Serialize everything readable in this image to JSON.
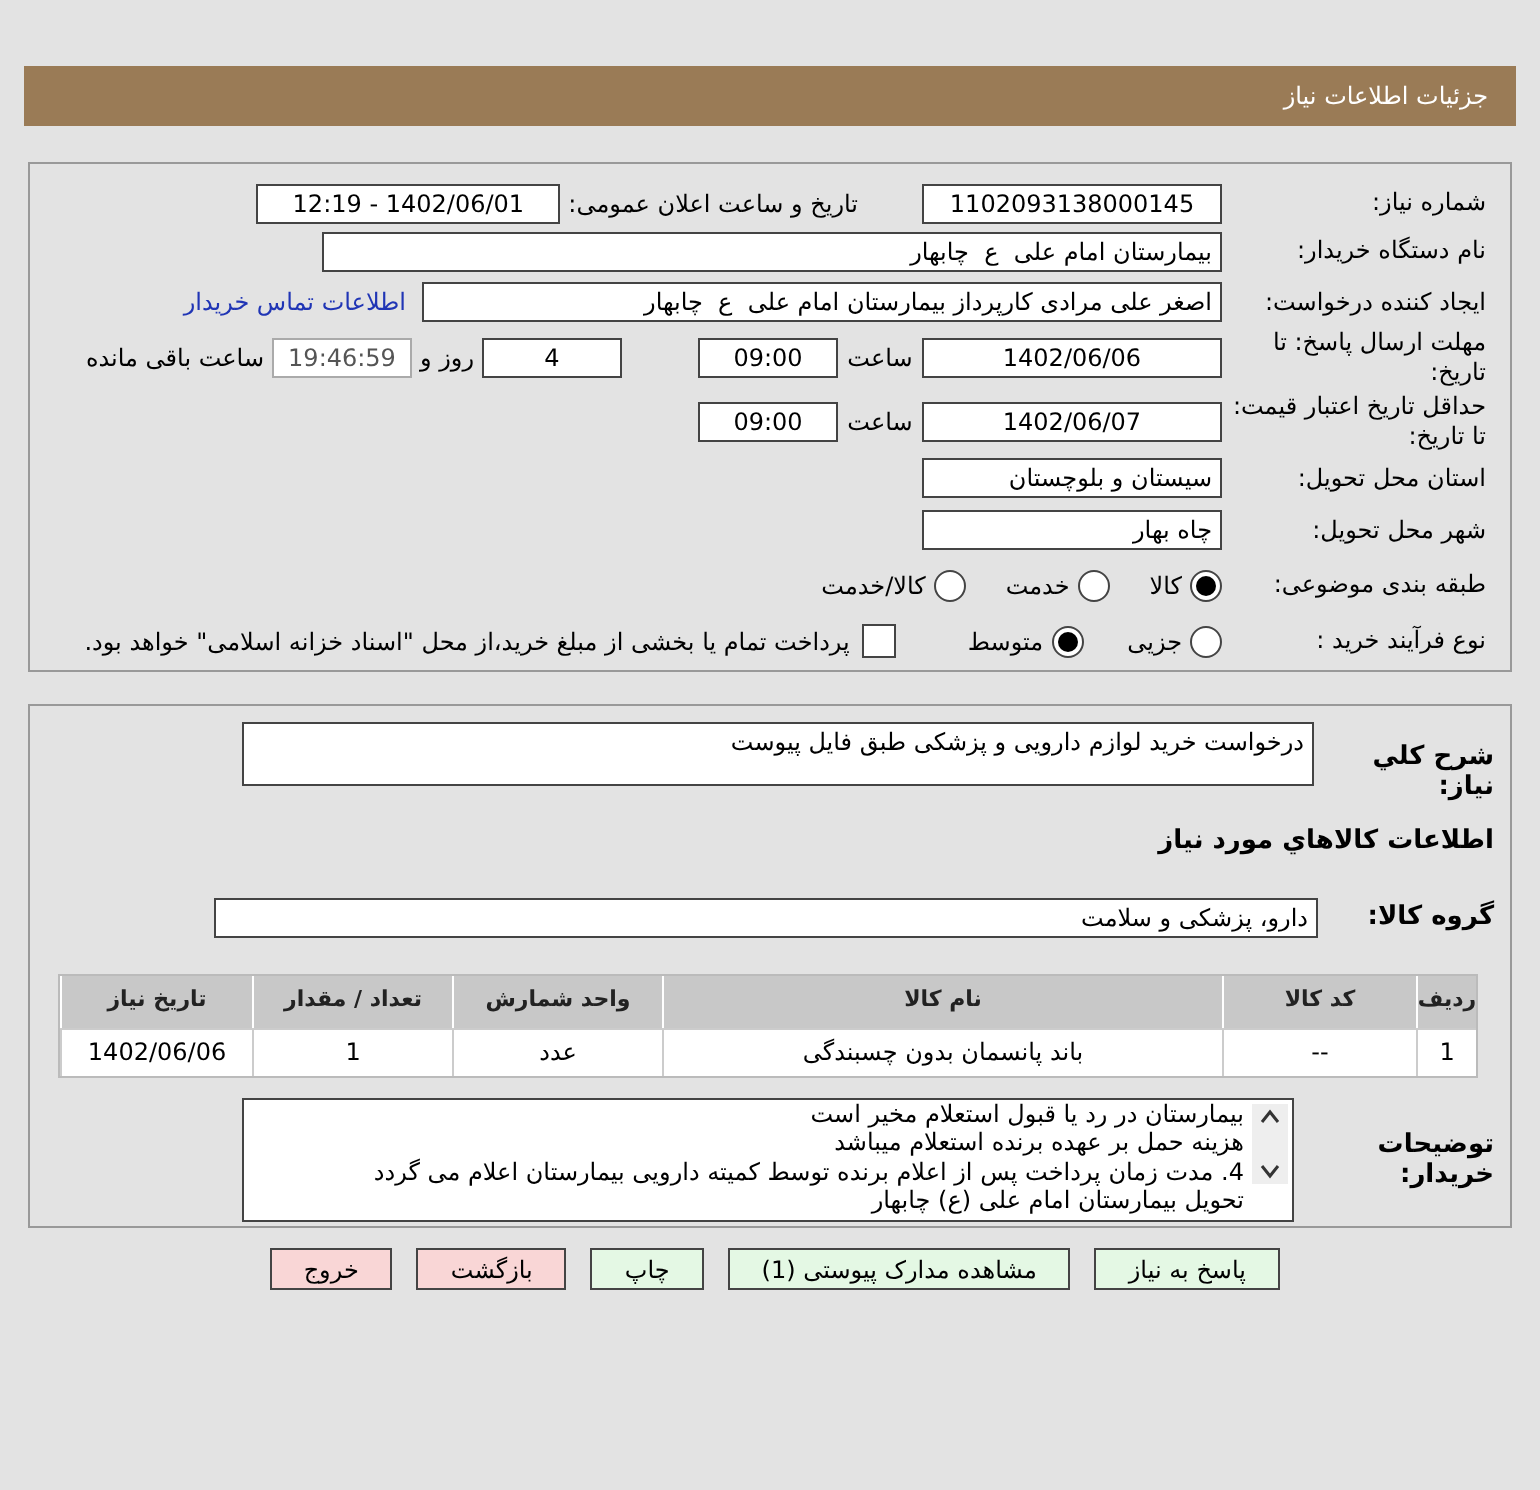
{
  "header": {
    "title": "جزئیات اطلاعات نیاز"
  },
  "need_number": {
    "label": "شماره نیاز:",
    "value": "1102093138000145"
  },
  "announce": {
    "label": "تاریخ و ساعت اعلان عمومی:",
    "value": "1402/06/01 - 12:19"
  },
  "buyer_org": {
    "label": "نام دستگاه خریدار:",
    "value": "بیمارستان امام علی  ع  چابهار"
  },
  "creator": {
    "label": "ایجاد کننده درخواست:",
    "value": "اصغر علی مرادی کارپرداز بیمارستان امام علی  ع  چابهار",
    "link": "اطلاعات تماس خریدار"
  },
  "deadline": {
    "label": "مهلت ارسال پاسخ: تا تاریخ:",
    "date": "1402/06/06",
    "time_label": "ساعت",
    "time": "09:00",
    "days": "4",
    "days_label": "روز و",
    "remaining": "19:46:59",
    "remaining_label": "ساعت باقی مانده"
  },
  "validity": {
    "label": "حداقل تاریخ اعتبار قیمت: تا تاریخ:",
    "date": "1402/06/07",
    "time_label": "ساعت",
    "time": "09:00"
  },
  "province": {
    "label": "استان محل تحویل:",
    "value": "سیستان و بلوچستان"
  },
  "city": {
    "label": "شهر محل تحویل:",
    "value": "چاه بهار"
  },
  "category": {
    "label": "طبقه بندی موضوعی:",
    "options": [
      {
        "label": "کالا",
        "selected": true
      },
      {
        "label": "خدمت",
        "selected": false
      },
      {
        "label": "کالا/خدمت",
        "selected": false
      }
    ]
  },
  "process": {
    "label": "نوع فرآیند خرید :",
    "options": [
      {
        "label": "جزیی",
        "selected": false
      },
      {
        "label": "متوسط",
        "selected": true
      }
    ],
    "treasury": {
      "label": "پرداخت تمام یا بخشی از مبلغ خرید،از محل \"اسناد خزانه اسلامی\" خواهد بود.",
      "checked": false
    }
  },
  "description": {
    "label": "شرح کلي نياز:",
    "value": "درخواست خرید لوازم دارویی و پزشکی طبق فایل پیوست"
  },
  "goods_heading": "اطلاعات کالاهاي مورد نياز",
  "goods_group": {
    "label": "گروه کالا:",
    "value": "دارو، پزشکی و سلامت"
  },
  "table": {
    "columns": [
      "ردیف",
      "کد کالا",
      "نام کالا",
      "واحد شمارش",
      "تعداد / مقدار",
      "تاریخ نیاز"
    ],
    "rows": [
      [
        "1",
        "--",
        "باند پانسمان بدون چسبندگی",
        "عدد",
        "1",
        "1402/06/06"
      ]
    ]
  },
  "buyer_notes": {
    "label": "توضیحات خریدار:",
    "lines": [
      "بیمارستان در رد یا قبول استعلام مخیر است",
      "هزینه حمل بر عهده برنده استعلام میباشد",
      "4. مدت زمان پرداخت پس از اعلام برنده توسط کمیته دارویی بیمارستان اعلام می گردد",
      "تحویل بیمارستان امام علی (ع) چابهار"
    ]
  },
  "buttons": [
    {
      "label": "پاسخ به نیاز",
      "kind": "go"
    },
    {
      "label": "مشاهده مدارک پیوستی (1)",
      "kind": "go"
    },
    {
      "label": "چاپ",
      "kind": "go"
    },
    {
      "label": "بازگشت",
      "kind": "stop"
    },
    {
      "label": "خروج",
      "kind": "stop"
    }
  ]
}
